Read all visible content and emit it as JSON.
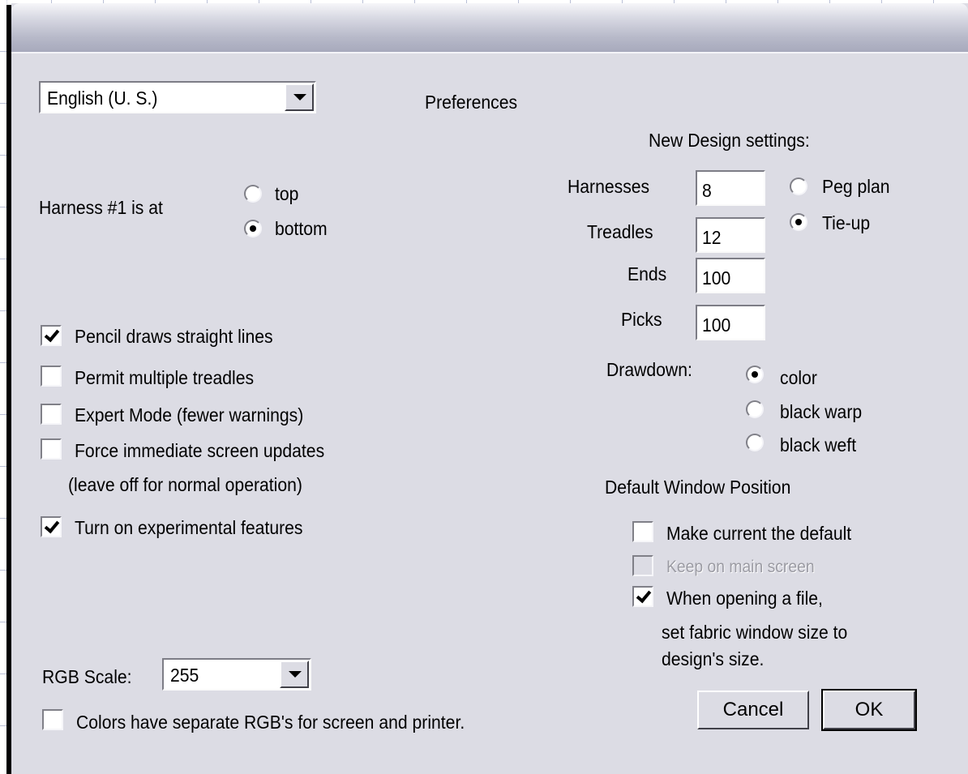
{
  "dialog": {
    "title": "Preferences",
    "language": {
      "selected": "English (U. S.)"
    },
    "harness_position": {
      "label": "Harness #1 is at",
      "options": [
        {
          "label": "top",
          "selected": false
        },
        {
          "label": "bottom",
          "selected": true
        }
      ]
    },
    "checkboxes": [
      {
        "label": "Pencil draws straight lines",
        "checked": true
      },
      {
        "label": "Permit multiple treadles",
        "checked": false
      },
      {
        "label": "Expert Mode (fewer warnings)",
        "checked": false
      },
      {
        "label": "Force immediate screen updates",
        "checked": false
      },
      {
        "label": "Turn on experimental features",
        "checked": true
      }
    ],
    "force_updates_note": "(leave off for normal operation)",
    "rgb_scale": {
      "label": "RGB Scale:",
      "selected": "255"
    },
    "separate_rgb": {
      "label": "Colors have separate RGB's for screen and printer.",
      "checked": false
    },
    "new_design": {
      "heading": "New Design settings:",
      "fields": [
        {
          "label": "Harnesses",
          "value": "8"
        },
        {
          "label": "Treadles",
          "value": "12"
        },
        {
          "label": "Ends",
          "value": "100"
        },
        {
          "label": "Picks",
          "value": "100"
        }
      ],
      "mode_options": [
        {
          "label": "Peg plan",
          "selected": false
        },
        {
          "label": "Tie-up",
          "selected": true
        }
      ]
    },
    "drawdown": {
      "label": "Drawdown:",
      "options": [
        {
          "label": "color",
          "selected": true
        },
        {
          "label": "black warp",
          "selected": false
        },
        {
          "label": "black weft",
          "selected": false
        }
      ]
    },
    "window_position": {
      "heading": "Default Window Position",
      "make_default": {
        "label": "Make current the default",
        "checked": false
      },
      "keep_main": {
        "label": "Keep on main screen",
        "checked": false,
        "enabled": false
      },
      "when_opening": {
        "label": "When opening a file,",
        "checked": true
      },
      "when_opening_line2": "set fabric window size to",
      "when_opening_line3": "design's size."
    },
    "buttons": {
      "cancel": "Cancel",
      "ok": "OK"
    }
  }
}
